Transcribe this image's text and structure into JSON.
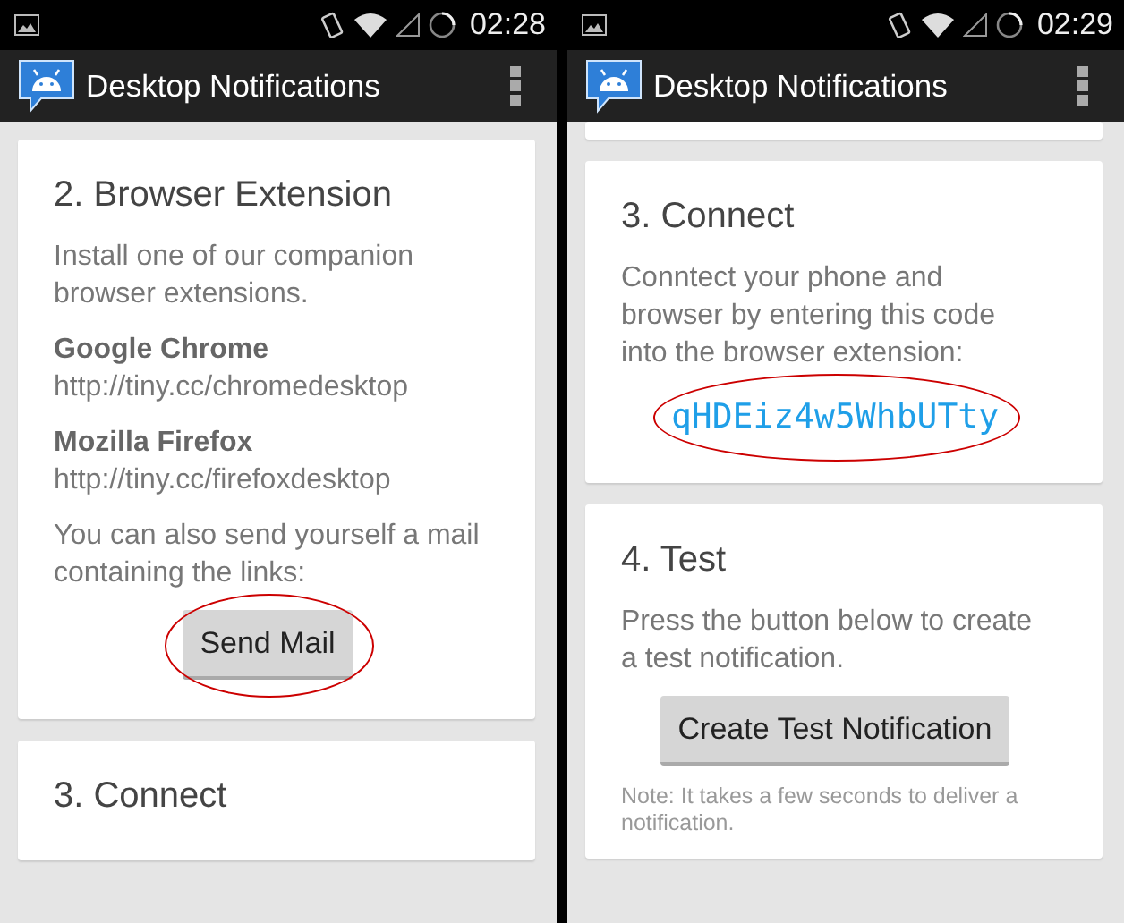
{
  "screens": [
    {
      "status_bar": {
        "time": "02:28"
      },
      "app_bar": {
        "title": "Desktop Notifications"
      },
      "cards": [
        {
          "cut_top": false,
          "blocks": [
            {
              "kind": "title",
              "text": "2. Browser Extension"
            },
            {
              "kind": "text",
              "text": "Install one of our companion browser extensions."
            },
            {
              "kind": "link",
              "label": "Google Chrome",
              "url": "http://tiny.cc/chromedesktop"
            },
            {
              "kind": "link",
              "label": "Mozilla Firefox",
              "url": "http://tiny.cc/firefoxdesktop"
            },
            {
              "kind": "text",
              "text": "You can also send yourself a mail containing the links:"
            },
            {
              "kind": "button",
              "text": "Send Mail",
              "highlighted": true
            }
          ]
        },
        {
          "cut_top": false,
          "blocks": [
            {
              "kind": "title",
              "text": "3. Connect"
            }
          ]
        }
      ]
    },
    {
      "status_bar": {
        "time": "02:29"
      },
      "app_bar": {
        "title": "Desktop Notifications"
      },
      "cards": [
        {
          "cut_top": true
        },
        {
          "cut_top": false,
          "blocks": [
            {
              "kind": "title",
              "text": "3. Connect"
            },
            {
              "kind": "text",
              "text": "Conntect your phone and browser by entering this code into the browser extension:"
            },
            {
              "kind": "code",
              "text": "qHDEiz4w5WhbUTty",
              "highlighted": true
            }
          ]
        },
        {
          "cut_top": false,
          "blocks": [
            {
              "kind": "title",
              "text": "4. Test"
            },
            {
              "kind": "text",
              "text": "Press the button below to create a test notification."
            },
            {
              "kind": "button",
              "text": "Create Test Notification",
              "highlighted": false
            },
            {
              "kind": "note",
              "text": "Note: It takes a few seconds to deliver a notification."
            }
          ]
        }
      ]
    }
  ]
}
